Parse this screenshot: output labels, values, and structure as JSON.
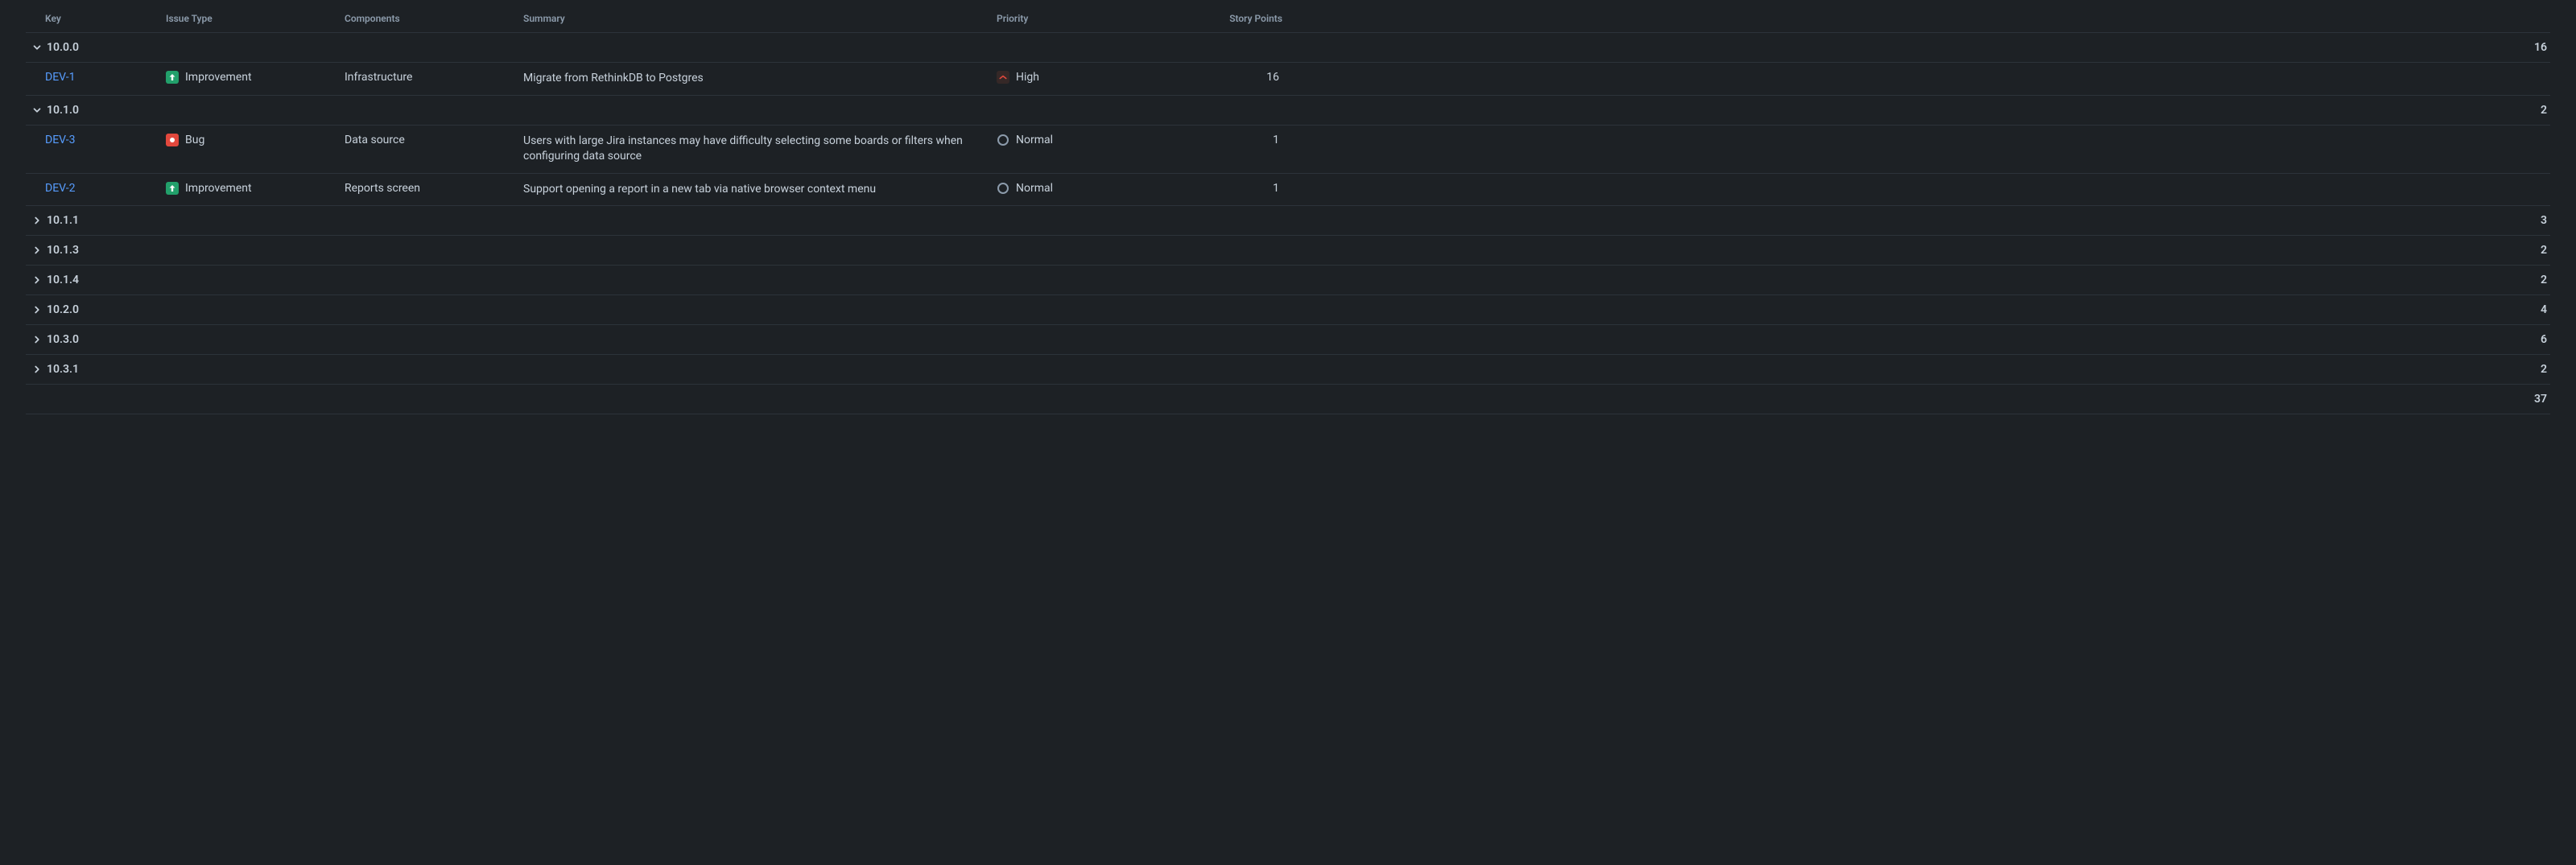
{
  "columns": {
    "key": "Key",
    "issue_type": "Issue Type",
    "components": "Components",
    "summary": "Summary",
    "priority": "Priority",
    "story_points": "Story Points"
  },
  "groups": [
    {
      "version": "10.0.0",
      "expanded": true,
      "points": "16",
      "rows": [
        {
          "key": "DEV-1",
          "issue_type": "Improvement",
          "issue_type_kind": "improvement",
          "components": "Infrastructure",
          "summary": "Migrate from RethinkDB to Postgres",
          "priority": "High",
          "priority_kind": "high",
          "points": "16"
        }
      ]
    },
    {
      "version": "10.1.0",
      "expanded": true,
      "points": "2",
      "rows": [
        {
          "key": "DEV-3",
          "issue_type": "Bug",
          "issue_type_kind": "bug",
          "components": "Data source",
          "summary": "Users with large Jira instances may have difficulty selecting some boards or filters when configuring data source",
          "priority": "Normal",
          "priority_kind": "normal",
          "points": "1"
        },
        {
          "key": "DEV-2",
          "issue_type": "Improvement",
          "issue_type_kind": "improvement",
          "components": "Reports screen",
          "summary": "Support opening a report in a new tab via native browser context menu",
          "priority": "Normal",
          "priority_kind": "normal",
          "points": "1"
        }
      ]
    },
    {
      "version": "10.1.1",
      "expanded": false,
      "points": "3",
      "rows": []
    },
    {
      "version": "10.1.3",
      "expanded": false,
      "points": "2",
      "rows": []
    },
    {
      "version": "10.1.4",
      "expanded": false,
      "points": "2",
      "rows": []
    },
    {
      "version": "10.2.0",
      "expanded": false,
      "points": "4",
      "rows": []
    },
    {
      "version": "10.3.0",
      "expanded": false,
      "points": "6",
      "rows": []
    },
    {
      "version": "10.3.1",
      "expanded": false,
      "points": "2",
      "rows": []
    }
  ],
  "total": "37"
}
